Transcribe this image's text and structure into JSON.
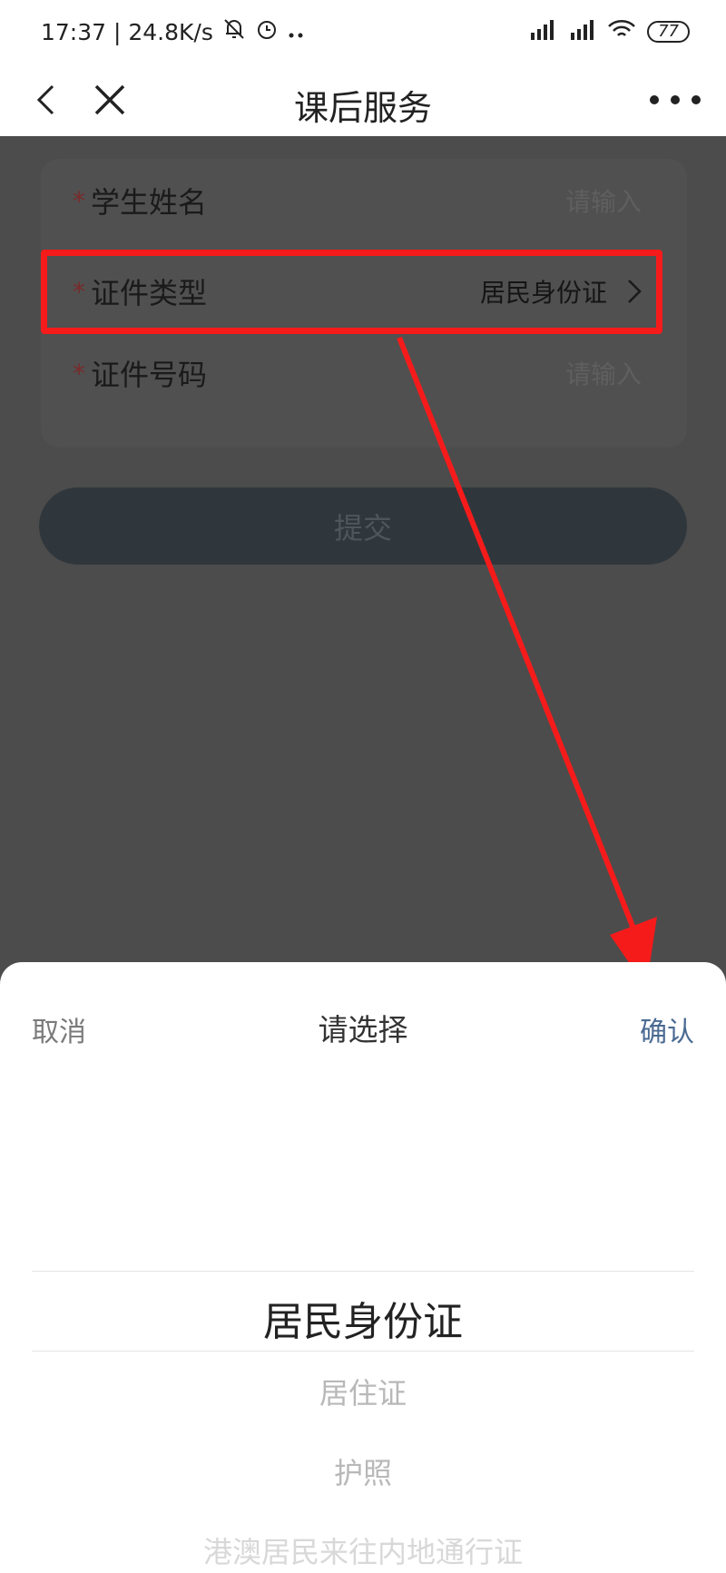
{
  "status_bar": {
    "time_speed": "17:37 | 24.8K/s",
    "battery": "77"
  },
  "nav": {
    "title": "课后服务"
  },
  "form": {
    "rows": [
      {
        "required_mark": "*",
        "label": "学生姓名",
        "value": "请输入"
      },
      {
        "required_mark": "*",
        "label": "证件类型",
        "value": "居民身份证"
      },
      {
        "required_mark": "*",
        "label": "证件号码",
        "value": "请输入"
      }
    ],
    "submit_label": "提交"
  },
  "sheet": {
    "cancel_label": "取消",
    "title": "请选择",
    "confirm_label": "确认",
    "options": [
      "居民身份证",
      "居住证",
      "护照",
      "港澳居民来往内地通行证"
    ],
    "selected_index": 0
  },
  "annotation": {
    "highlight_color": "#f61b1b"
  }
}
